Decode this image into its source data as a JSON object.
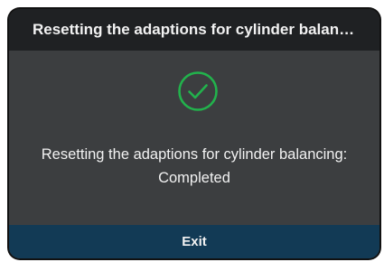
{
  "dialog": {
    "title": "Resetting the adaptions for cylinder balan…",
    "status_icon": "check-circle-icon",
    "status_color": "#22b24c",
    "message": "Resetting the adaptions for cylinder balancing: Completed",
    "exit_label": "Exit",
    "colors": {
      "background": "#3c3e40",
      "title_bar": "#1f2123",
      "button": "#123a55"
    }
  }
}
